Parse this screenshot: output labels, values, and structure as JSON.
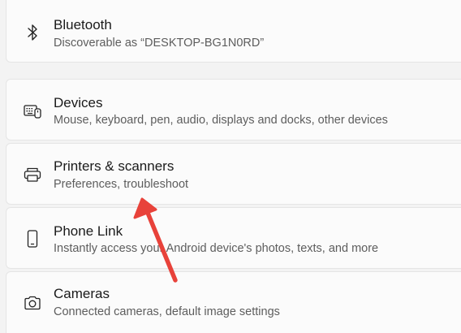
{
  "items": [
    {
      "title": "Bluetooth",
      "subtitle": "Discoverable as “DESKTOP-BG1N0RD”",
      "icon": "bluetooth-icon"
    },
    {
      "title": "Devices",
      "subtitle": "Mouse, keyboard, pen, audio, displays and docks, other devices",
      "icon": "devices-icon"
    },
    {
      "title": "Printers & scanners",
      "subtitle": "Preferences, troubleshoot",
      "icon": "printer-icon"
    },
    {
      "title": "Phone Link",
      "subtitle": "Instantly access your Android device's photos, texts, and more",
      "icon": "phone-icon"
    },
    {
      "title": "Cameras",
      "subtitle": "Connected cameras, default image settings",
      "icon": "camera-icon"
    }
  ],
  "annotation": {
    "color": "#e8423a",
    "target": "Printers & scanners"
  }
}
